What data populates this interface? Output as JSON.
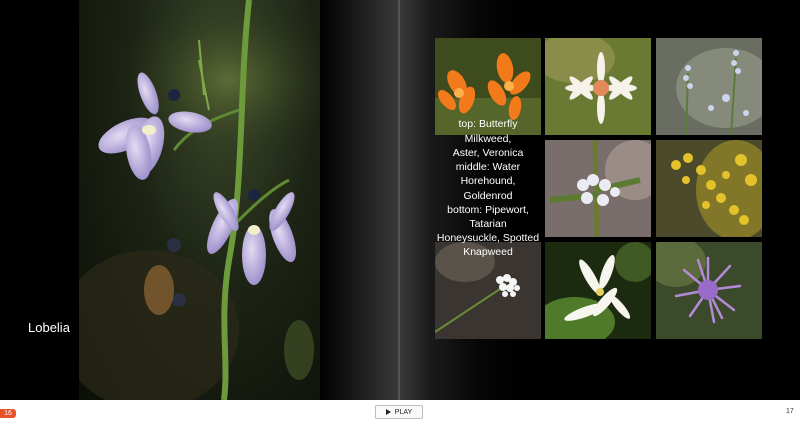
{
  "left_page": {
    "caption": "Lobelia",
    "page_number": "16"
  },
  "right_page": {
    "caption_lines": [
      "top: Butterfly Milkweed,",
      "Aster, Veronica",
      "middle: Water Horehound,",
      "Goldenrod",
      "bottom: Pipewort, Tatarian",
      "Honeysuckle, Spotted",
      "Knapweed"
    ],
    "page_number": "17"
  },
  "controls": {
    "play_label": "PLAY"
  },
  "colors": {
    "badge": "#e8522b",
    "page_background": "#000000"
  }
}
